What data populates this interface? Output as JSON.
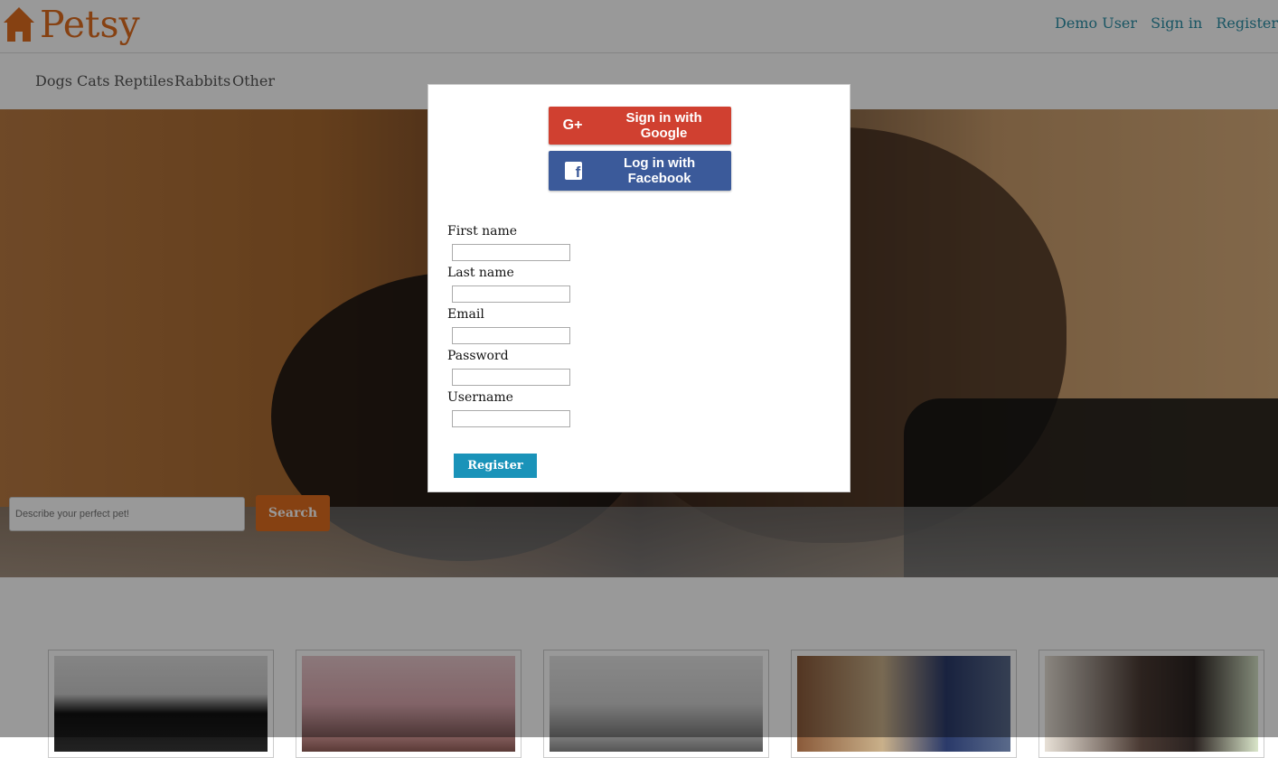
{
  "header": {
    "brand": "Petsy",
    "links": [
      "Demo User",
      "Sign in",
      "Register"
    ]
  },
  "nav": {
    "categories": [
      "Dogs",
      "Cats",
      "Reptiles",
      "Rabbits",
      "Other"
    ]
  },
  "hero": {
    "search_placeholder": "Describe your perfect pet!",
    "search_button": "Search"
  },
  "modal": {
    "google_label": "Sign in with Google",
    "google_icon": "G+",
    "facebook_label": "Log in with Facebook",
    "facebook_icon": "f",
    "fields": [
      {
        "label": "First name",
        "value": ""
      },
      {
        "label": "Last name",
        "value": ""
      },
      {
        "label": "Email",
        "value": ""
      },
      {
        "label": "Password",
        "value": ""
      },
      {
        "label": "Username",
        "value": ""
      }
    ],
    "submit_label": "Register"
  },
  "colors": {
    "brand": "#e06d1f",
    "link": "#2a8ea6",
    "google": "#d04030",
    "facebook": "#3b5a9a",
    "register": "#1a93b9"
  }
}
